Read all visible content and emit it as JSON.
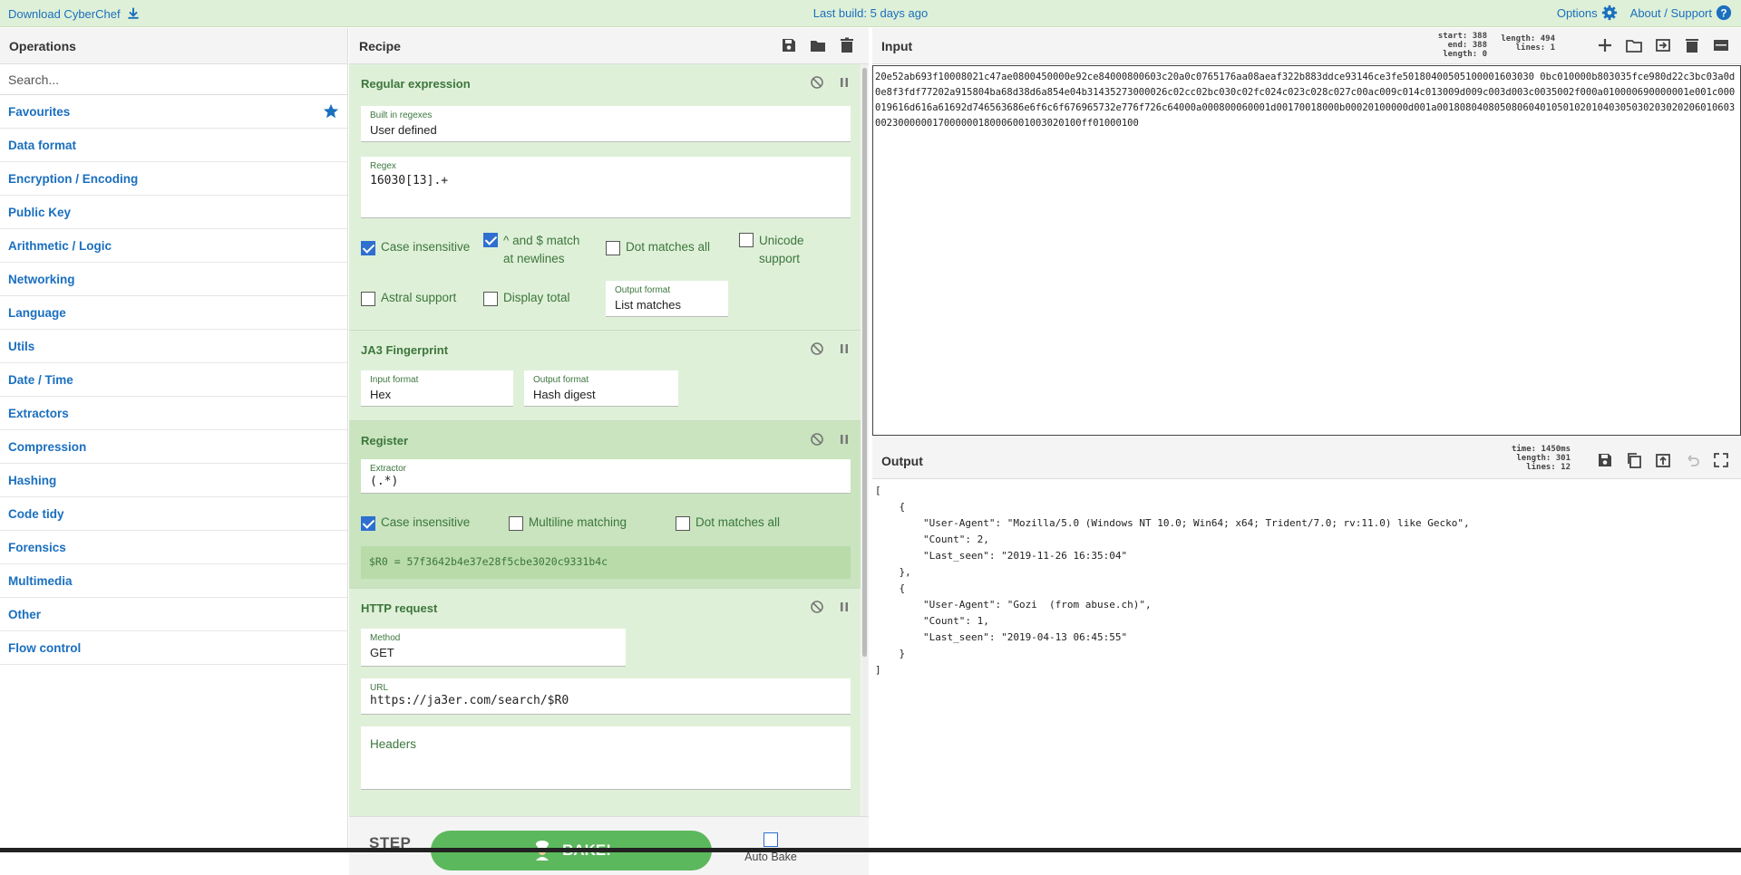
{
  "banner": {
    "download": "Download CyberChef",
    "last_build": "Last build: 5 days ago",
    "options": "Options",
    "about": "About / Support"
  },
  "operations": {
    "title": "Operations",
    "search_placeholder": "Search...",
    "categories": [
      "Favourites",
      "Data format",
      "Encryption / Encoding",
      "Public Key",
      "Arithmetic / Logic",
      "Networking",
      "Language",
      "Utils",
      "Date / Time",
      "Extractors",
      "Compression",
      "Hashing",
      "Code tidy",
      "Forensics",
      "Multimedia",
      "Other",
      "Flow control"
    ]
  },
  "recipe": {
    "title": "Recipe",
    "regex": {
      "title": "Regular expression",
      "builtin_label": "Built in regexes",
      "builtin_value": "User defined",
      "regex_label": "Regex",
      "regex_value": "16030[13].+",
      "case_insensitive": "Case insensitive",
      "anchors": "^ and $ match at newlines",
      "dot_all": "Dot matches all",
      "unicode": "Unicode support",
      "astral": "Astral support",
      "display_total": "Display total",
      "output_label": "Output format",
      "output_value": "List matches"
    },
    "ja3": {
      "title": "JA3 Fingerprint",
      "input_label": "Input format",
      "input_value": "Hex",
      "output_label": "Output format",
      "output_value": "Hash digest"
    },
    "register": {
      "title": "Register",
      "extractor_label": "Extractor",
      "extractor_value": "(.*)",
      "case_insensitive": "Case insensitive",
      "multiline": "Multiline matching",
      "dot_all": "Dot matches all",
      "result": "$R0 = 57f3642b4e37e28f5cbe3020c9331b4c"
    },
    "http": {
      "title": "HTTP request",
      "method_label": "Method",
      "method_value": "GET",
      "url_label": "URL",
      "url_value": "https://ja3er.com/search/$R0",
      "headers_label": "Headers"
    },
    "step": "STEP",
    "bake": "BAKE!",
    "auto_bake": "Auto Bake"
  },
  "input": {
    "title": "Input",
    "stats_left": "start: 388\nend: 388\nlength: 0",
    "stats_right": "length: 494\nlines: 1",
    "text": "20e52ab693f10008021c47ae0800450000e92ce84000800603c20a0c0765176aa08aeaf322b883ddce93146ce3fe50180400505100001603030 0bc010000b803035fce980d22c3bc03a0d0e8f3fdf77202a915804ba68d38d6a854e04b31435273000026c02cc02bc030c02fc024c023c028c027c00ac009c014c013009d009c003d003c0035002f000a010000690000001e001c000019616d616a61692d746563686e6f6c6f676965732e776f726c64000a000800060001d00170018000b00020100000d001a0018080408050806040105010201040305030203020206010603002300000017000000180006001003020100ff01000100"
  },
  "output": {
    "title": "Output",
    "stats": "time: 1450ms\nlength: 301\nlines: 12",
    "text": "[\n    {\n        \"User-Agent\": \"Mozilla/5.0 (Windows NT 10.0; Win64; x64; Trident/7.0; rv:11.0) like Gecko\",\n        \"Count\": 2,\n        \"Last_seen\": \"2019-11-26 16:35:04\"\n    },\n    {\n        \"User-Agent\": \"Gozi  (from abuse.ch)\",\n        \"Count\": 1,\n        \"Last_seen\": \"2019-04-13 06:45:55\"\n    }\n]"
  }
}
